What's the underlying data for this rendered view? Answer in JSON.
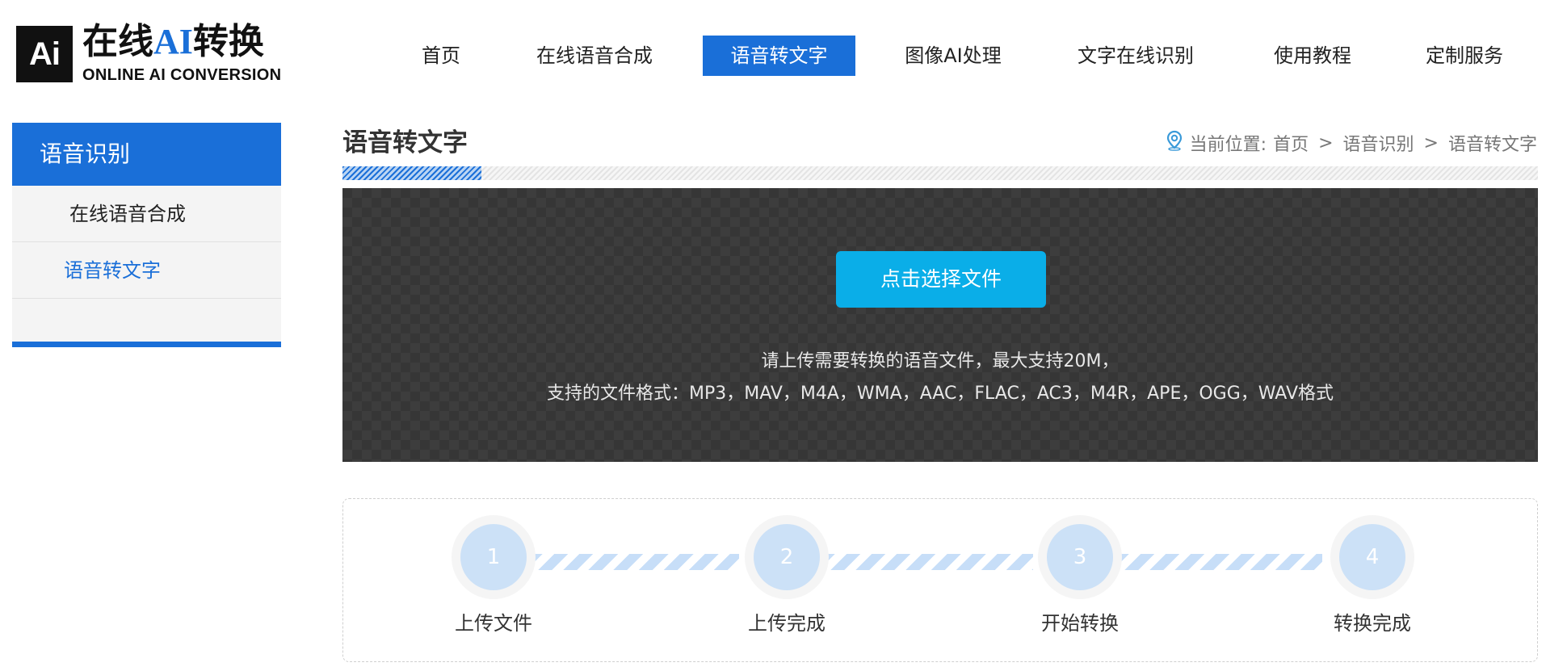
{
  "logo": {
    "badge": "Ai",
    "title_pre": "在线",
    "title_ai": "AI",
    "title_post": "转换",
    "subtitle": "ONLINE AI CONVERSION"
  },
  "nav": {
    "items": [
      {
        "label": "首页"
      },
      {
        "label": "在线语音合成"
      },
      {
        "label": "语音转文字",
        "active": true
      },
      {
        "label": "图像AI处理"
      },
      {
        "label": "文字在线识别"
      },
      {
        "label": "使用教程"
      },
      {
        "label": "定制服务"
      }
    ]
  },
  "sidebar": {
    "heading": "语音识别",
    "items": [
      {
        "label": "在线语音合成"
      },
      {
        "label": "语音转文字",
        "current": true
      }
    ]
  },
  "page": {
    "title": "语音转文字"
  },
  "breadcrumb": {
    "prefix": "当前位置:",
    "items": [
      "首页",
      "语音识别",
      "语音转文字"
    ],
    "separator": ">"
  },
  "upload": {
    "button_label": "点击选择文件",
    "hint_line1": "请上传需要转换的语音文件，最大支持20M，",
    "hint_line2": "支持的文件格式：MP3，MAV，M4A，WMA，AAC，FLAC，AC3，M4R，APE，OGG，WAV格式"
  },
  "steps": [
    {
      "number": "1",
      "label": "上传文件"
    },
    {
      "number": "2",
      "label": "上传完成"
    },
    {
      "number": "3",
      "label": "开始转换"
    },
    {
      "number": "4",
      "label": "转换完成"
    }
  ],
  "colors": {
    "accent": "#1a6fd8",
    "upload_button": "#0aaee8",
    "upload_bg": "#363636",
    "step_circle": "#cce1f7"
  },
  "icons": {
    "breadcrumb": "location-pin-icon"
  }
}
